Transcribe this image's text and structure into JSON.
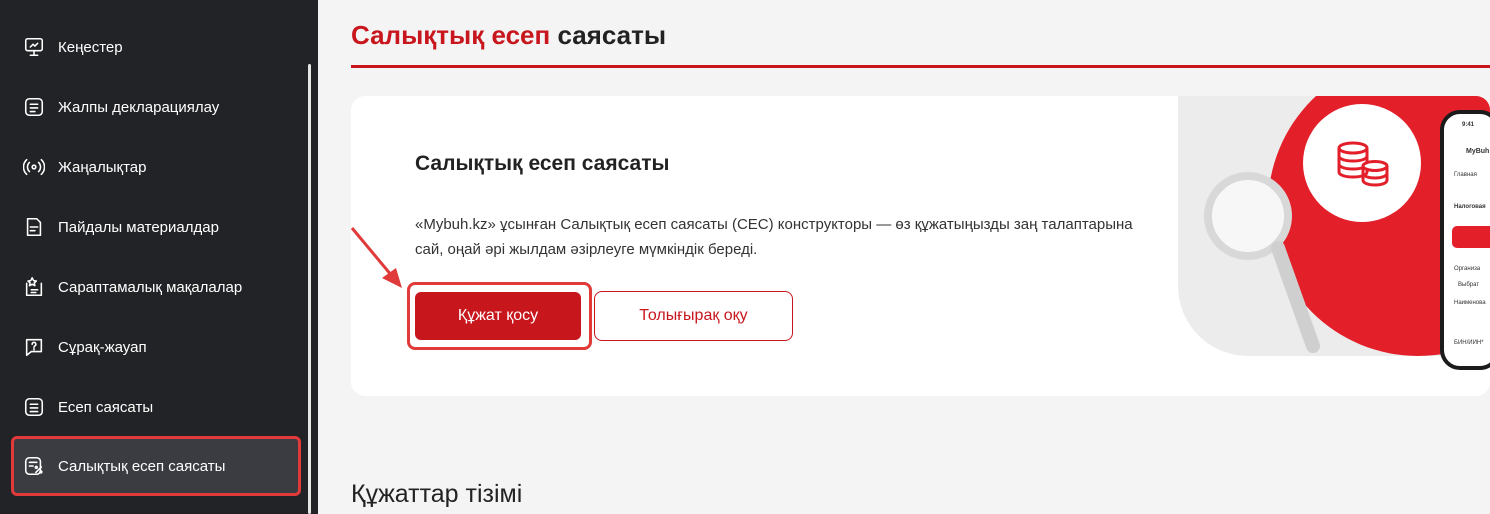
{
  "sidebar": {
    "items": [
      {
        "label": "Кеңестер",
        "icon": "presentation-icon"
      },
      {
        "label": "Жалпы декларациялау",
        "icon": "list-icon"
      },
      {
        "label": "Жаңалықтар",
        "icon": "broadcast-icon"
      },
      {
        "label": "Пайдалы материалдар",
        "icon": "document-icon"
      },
      {
        "label": "Сараптамалық мақалалар",
        "icon": "star-document-icon"
      },
      {
        "label": "Сұрақ-жауап",
        "icon": "question-icon"
      },
      {
        "label": "Есеп саясаты",
        "icon": "list-icon"
      },
      {
        "label": "Салықтық есеп саясаты",
        "icon": "tax-document-icon",
        "active": true
      }
    ]
  },
  "main": {
    "title_accent": "Салықтық есеп",
    "title_rest": "саясаты",
    "card": {
      "title": "Салықтық есеп саясаты",
      "description": "«Mybuh.kz» ұсынған Салықтық есеп саясаты (СЕС) конструкторы — өз құжатыңызды заң талаптарына сай, оңай әрі жылдам әзірлеуге мүмкіндік береді.",
      "primary_button": "Құжат қосу",
      "secondary_button": "Толығырақ оқу"
    },
    "section_title": "Құжаттар тізімі"
  },
  "illustration": {
    "phone_time": "9:41",
    "phone_brand": "MyBuh",
    "phone_lines": [
      "Главная",
      "Налоговая",
      "Организа",
      "Выбрат",
      "Наименова",
      "БИН/ИИН*"
    ]
  },
  "colors": {
    "accent": "#c8161d",
    "sidebar_bg": "#222326",
    "highlight": "#e03a3a"
  }
}
